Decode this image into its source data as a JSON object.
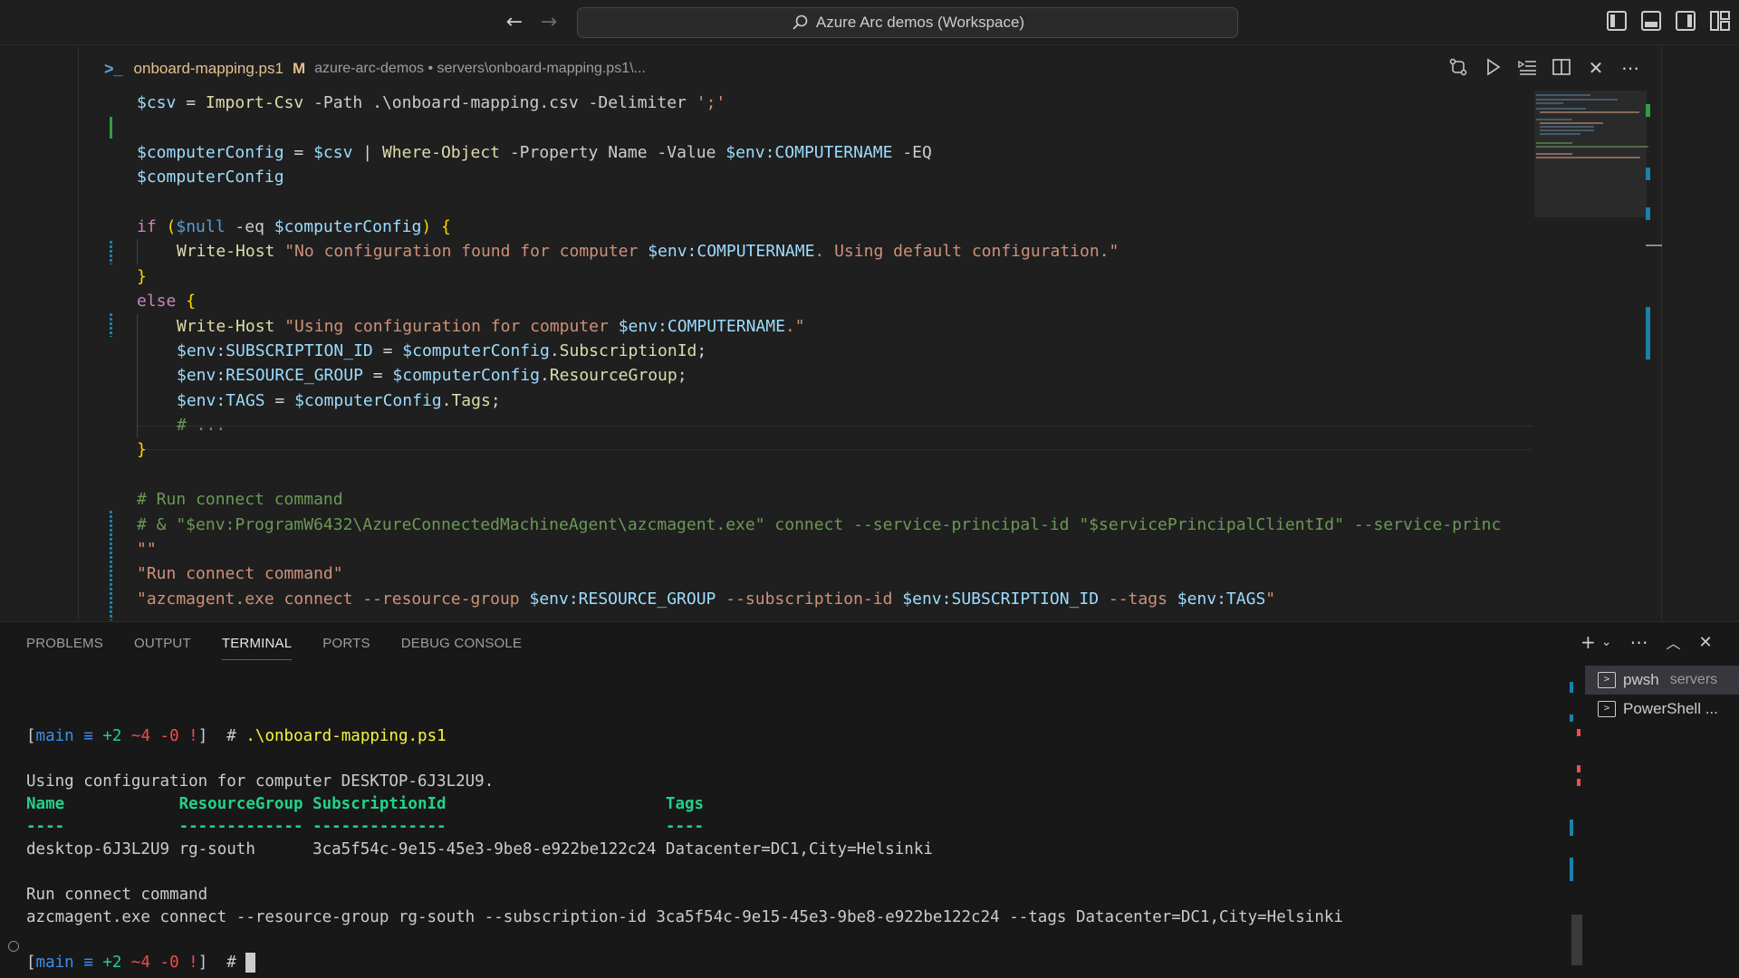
{
  "titlebar": {
    "workspace_title": "Azure Arc demos (Workspace)",
    "back_icon": "arrow-left-icon",
    "forward_icon": "arrow-right-icon"
  },
  "editor": {
    "tab": {
      "filename": "onboard-mapping.ps1",
      "modified": "M",
      "breadcrumb": "azure-arc-demos • servers\\onboard-mapping.ps1\\..."
    },
    "lines": [
      [
        {
          "t": "$csv",
          "c": "var"
        },
        {
          "t": " = ",
          "c": "op"
        },
        {
          "t": "Import-Csv",
          "c": "cmd"
        },
        {
          "t": " -Path .\\onboard-mapping.csv -Delimiter ",
          "c": "par"
        },
        {
          "t": "';'",
          "c": "str"
        }
      ],
      [],
      [
        {
          "t": "$computerConfig",
          "c": "var"
        },
        {
          "t": " = ",
          "c": "op"
        },
        {
          "t": "$csv",
          "c": "var"
        },
        {
          "t": " | ",
          "c": "op"
        },
        {
          "t": "Where-Object",
          "c": "cmd"
        },
        {
          "t": " -Property Name -Value ",
          "c": "par"
        },
        {
          "t": "$env:COMPUTERNAME",
          "c": "var"
        },
        {
          "t": " -EQ",
          "c": "par"
        }
      ],
      [
        {
          "t": "$computerConfig",
          "c": "var"
        }
      ],
      [],
      [
        {
          "t": "if",
          "c": "kw"
        },
        {
          "t": " ",
          "c": "op"
        },
        {
          "t": "(",
          "c": "br"
        },
        {
          "t": "$null",
          "c": "null"
        },
        {
          "t": " -eq ",
          "c": "par"
        },
        {
          "t": "$computerConfig",
          "c": "var"
        },
        {
          "t": ")",
          "c": "br"
        },
        {
          "t": " ",
          "c": "op"
        },
        {
          "t": "{",
          "c": "br"
        }
      ],
      [
        {
          "i": 1
        },
        {
          "t": "Write-Host",
          "c": "cmd"
        },
        {
          "t": " ",
          "c": "op"
        },
        {
          "t": "\"No configuration found for computer ",
          "c": "str"
        },
        {
          "t": "$env:COMPUTERNAME",
          "c": "var"
        },
        {
          "t": ". Using default configuration.\"",
          "c": "str"
        }
      ],
      [
        {
          "t": "}",
          "c": "br"
        }
      ],
      [
        {
          "t": "else",
          "c": "kw"
        },
        {
          "t": " ",
          "c": "op"
        },
        {
          "t": "{",
          "c": "br"
        }
      ],
      [
        {
          "i": 1
        },
        {
          "t": "Write-Host",
          "c": "cmd"
        },
        {
          "t": " ",
          "c": "op"
        },
        {
          "t": "\"Using configuration for computer ",
          "c": "str"
        },
        {
          "t": "$env:COMPUTERNAME",
          "c": "var"
        },
        {
          "t": ".\"",
          "c": "str"
        }
      ],
      [
        {
          "i": 1
        },
        {
          "t": "$env:SUBSCRIPTION_ID",
          "c": "var"
        },
        {
          "t": " = ",
          "c": "op"
        },
        {
          "t": "$computerConfig",
          "c": "var"
        },
        {
          "t": ".",
          "c": "op"
        },
        {
          "t": "SubscriptionId",
          "c": "cmd"
        },
        {
          "t": ";",
          "c": "op"
        }
      ],
      [
        {
          "i": 1
        },
        {
          "t": "$env:RESOURCE_GROUP",
          "c": "var"
        },
        {
          "t": " = ",
          "c": "op"
        },
        {
          "t": "$computerConfig",
          "c": "var"
        },
        {
          "t": ".",
          "c": "op"
        },
        {
          "t": "ResourceGroup",
          "c": "cmd"
        },
        {
          "t": ";",
          "c": "op"
        }
      ],
      [
        {
          "i": 1
        },
        {
          "t": "$env:TAGS",
          "c": "var"
        },
        {
          "t": " = ",
          "c": "op"
        },
        {
          "t": "$computerConfig",
          "c": "var"
        },
        {
          "t": ".",
          "c": "op"
        },
        {
          "t": "Tags",
          "c": "cmd"
        },
        {
          "t": ";",
          "c": "op"
        }
      ],
      [
        {
          "i": 1
        },
        {
          "t": "# ...",
          "c": "com"
        }
      ],
      [
        {
          "t": "}",
          "c": "br"
        }
      ],
      [],
      [
        {
          "t": "# Run connect command",
          "c": "com"
        }
      ],
      [
        {
          "t": "# & \"$env:ProgramW6432\\AzureConnectedMachineAgent\\azcmagent.exe\" connect --service-principal-id \"$servicePrincipalClientId\" --service-princ",
          "c": "com"
        }
      ],
      [
        {
          "t": "\"\"",
          "c": "str"
        }
      ],
      [
        {
          "t": "\"Run connect command\"",
          "c": "str"
        }
      ],
      [
        {
          "t": "\"azcmagent.exe connect --resource-group ",
          "c": "str"
        },
        {
          "t": "$env:RESOURCE_GROUP",
          "c": "var"
        },
        {
          "t": " --subscription-id ",
          "c": "str"
        },
        {
          "t": "$env:SUBSCRIPTION_ID",
          "c": "var"
        },
        {
          "t": " --tags ",
          "c": "str"
        },
        {
          "t": "$env:TAGS",
          "c": "var"
        },
        {
          "t": "\"",
          "c": "str"
        }
      ]
    ]
  },
  "panel": {
    "tabs": [
      "PROBLEMS",
      "OUTPUT",
      "TERMINAL",
      "PORTS",
      "DEBUG CONSOLE"
    ],
    "active_tab": "TERMINAL",
    "terminal_lines": [
      [],
      [
        {
          "t": "[",
          "c": "br"
        },
        {
          "t": "main",
          "c": "blue"
        },
        {
          "t": " ≡ ",
          "c": "blue"
        },
        {
          "t": "+2",
          "c": "green"
        },
        {
          "t": " ~4",
          "c": "red"
        },
        {
          "t": " -0",
          "c": "red"
        },
        {
          "t": " !",
          "c": "red"
        },
        {
          "t": "]",
          "c": "br"
        },
        {
          "t": "  # ",
          "c": "br"
        },
        {
          "t": ".\\onboard-mapping.ps1",
          "c": "yellow"
        }
      ],
      [],
      [
        {
          "t": "Using configuration for computer DESKTOP-6J3L2U9.",
          "c": "br"
        }
      ],
      [
        {
          "t": "Name            ResourceGroup SubscriptionId                       Tags",
          "c": "head"
        }
      ],
      [
        {
          "t": "----            ------------- --------------                       ----",
          "c": "head"
        }
      ],
      [
        {
          "t": "desktop-6J3L2U9 rg-south      3ca5f54c-9e15-45e3-9be8-e922be122c24 Datacenter=DC1,City=Helsinki",
          "c": "br"
        }
      ],
      [],
      [
        {
          "t": "Run connect command",
          "c": "br"
        }
      ],
      [
        {
          "t": "azcmagent.exe connect --resource-group rg-south --subscription-id 3ca5f54c-9e15-45e3-9be8-e922be122c24 --tags Datacenter=DC1,City=Helsinki",
          "c": "br"
        }
      ],
      [],
      [
        {
          "t": "[",
          "c": "br"
        },
        {
          "t": "main",
          "c": "blue"
        },
        {
          "t": " ≡ ",
          "c": "blue"
        },
        {
          "t": "+2",
          "c": "green"
        },
        {
          "t": " ~4",
          "c": "red"
        },
        {
          "t": " -0",
          "c": "red"
        },
        {
          "t": " !",
          "c": "red"
        },
        {
          "t": "]",
          "c": "br"
        },
        {
          "t": "  # ",
          "c": "br"
        },
        {
          "cursor": true
        }
      ]
    ],
    "terminals": [
      {
        "name": "pwsh",
        "desc": "servers",
        "active": true
      },
      {
        "name": "PowerShell ...",
        "desc": "",
        "active": false
      }
    ]
  },
  "colors": {
    "accent": "#0078d4",
    "background": "#1f1f1f",
    "panel_background": "#181818"
  }
}
